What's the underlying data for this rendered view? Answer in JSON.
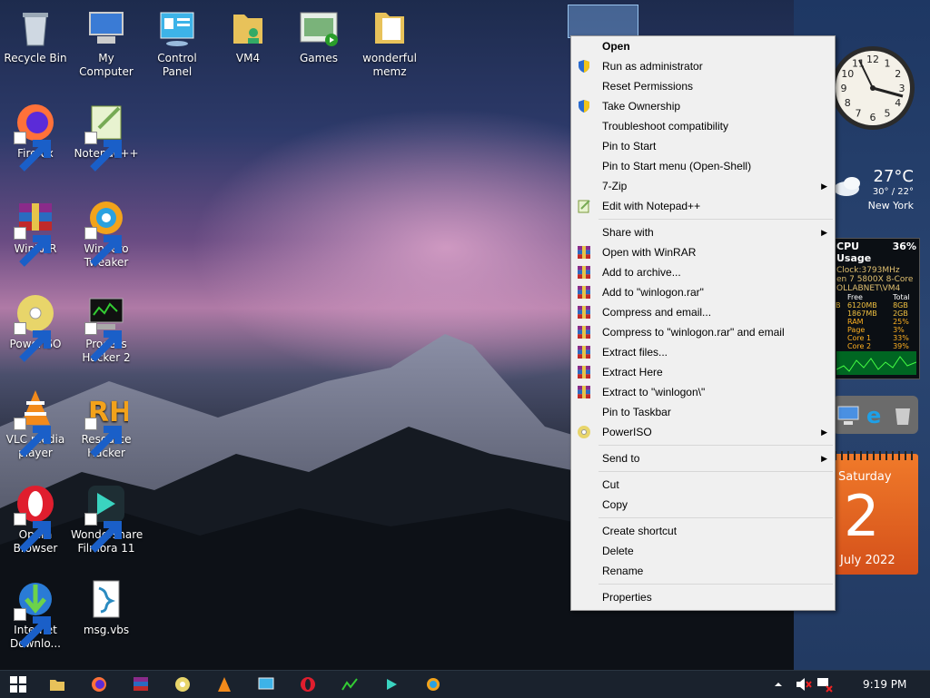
{
  "desktop": {
    "icons": [
      {
        "label": "Recycle Bin",
        "icon": "recycle-bin-icon"
      },
      {
        "label": "My Computer",
        "icon": "computer-icon"
      },
      {
        "label": "Control Panel",
        "icon": "control-panel-icon"
      },
      {
        "label": "VM4",
        "icon": "folder-user-icon"
      },
      {
        "label": "Games",
        "icon": "games-folder-icon"
      },
      {
        "label": "wonderful memz",
        "icon": "folder-icon"
      },
      {
        "label": "Firefox",
        "icon": "firefox-icon"
      },
      {
        "label": "Notepad++",
        "icon": "notepad-plus-plus-icon"
      },
      {
        "label": "WinRAR",
        "icon": "winrar-icon"
      },
      {
        "label": "Winaero Tweaker",
        "icon": "winaero-tweaker-icon"
      },
      {
        "label": "PowerISO",
        "icon": "poweriso-icon"
      },
      {
        "label": "Process Hacker 2",
        "icon": "process-hacker-icon"
      },
      {
        "label": "VLC media player",
        "icon": "vlc-icon"
      },
      {
        "label": "Resource Hacker",
        "icon": "resource-hacker-icon"
      },
      {
        "label": "Opera Browser",
        "icon": "opera-icon"
      },
      {
        "label": "Wondershare Filmora 11",
        "icon": "filmora-icon"
      },
      {
        "label": "Internet Downlo...",
        "icon": "internet-download-manager-icon"
      },
      {
        "label": "msg.vbs",
        "icon": "vbs-script-icon"
      }
    ]
  },
  "context_menu": {
    "groups": [
      [
        {
          "label": "Open",
          "bold": true
        },
        {
          "label": "Run as administrator",
          "icon": "uac-shield-icon"
        },
        {
          "label": "Reset Permissions"
        },
        {
          "label": "Take Ownership",
          "icon": "uac-shield-icon"
        },
        {
          "label": "Troubleshoot compatibility"
        },
        {
          "label": "Pin to Start"
        },
        {
          "label": "Pin to Start menu (Open-Shell)"
        },
        {
          "label": "7-Zip",
          "submenu": true
        },
        {
          "label": "Edit with Notepad++",
          "icon": "notepad-plus-plus-icon"
        }
      ],
      [
        {
          "label": "Share with",
          "submenu": true
        },
        {
          "label": "Open with WinRAR",
          "icon": "winrar-icon"
        },
        {
          "label": "Add to archive...",
          "icon": "winrar-icon"
        },
        {
          "label": "Add to \"winlogon.rar\"",
          "icon": "winrar-icon"
        },
        {
          "label": "Compress and email...",
          "icon": "winrar-icon"
        },
        {
          "label": "Compress to \"winlogon.rar\" and email",
          "icon": "winrar-icon"
        },
        {
          "label": "Extract files...",
          "icon": "winrar-icon"
        },
        {
          "label": "Extract Here",
          "icon": "winrar-icon"
        },
        {
          "label": "Extract to \"winlogon\\\"",
          "icon": "winrar-icon"
        },
        {
          "label": "Pin to Taskbar"
        },
        {
          "label": "PowerISO",
          "icon": "poweriso-icon",
          "submenu": true
        }
      ],
      [
        {
          "label": "Send to",
          "submenu": true
        }
      ],
      [
        {
          "label": "Cut"
        },
        {
          "label": "Copy"
        }
      ],
      [
        {
          "label": "Create shortcut"
        },
        {
          "label": "Delete"
        },
        {
          "label": "Rename"
        }
      ],
      [
        {
          "label": "Properties"
        }
      ]
    ]
  },
  "gadgets": {
    "clock": {
      "numerals": [
        "12",
        "1",
        "2",
        "3",
        "4",
        "5",
        "6",
        "7",
        "8",
        "9",
        "10",
        "11"
      ]
    },
    "weather": {
      "temp": "27°C",
      "range": "30° / 22°",
      "city": "New York"
    },
    "cpu": {
      "title": "CPU Usage",
      "usage": "36%",
      "clock": "Clock:3793MHz",
      "model": "en 7 5800X 8-Core",
      "machine": "OLLABNET\\VM4",
      "headers": [
        "",
        "Free",
        "Total"
      ],
      "rows": [
        [
          "B",
          "6120MB",
          "8GB"
        ],
        [
          "",
          "1867MB",
          "2GB"
        ]
      ],
      "stats": [
        {
          "label": "RAM",
          "value": "25%"
        },
        {
          "label": "Page",
          "value": "3%"
        },
        {
          "label": "Core 1",
          "value": "33%"
        },
        {
          "label": "Core 2",
          "value": "39%"
        }
      ]
    },
    "calendar": {
      "weekday": "Saturday",
      "day": "2",
      "month_year": "July 2022"
    }
  },
  "taskbar": {
    "time": "9:19 PM",
    "apps": [
      "start-icon",
      "file-explorer-icon",
      "firefox-icon",
      "winrar-icon",
      "poweriso-icon",
      "vlc-icon",
      "control-panel-icon",
      "opera-icon",
      "process-hacker-icon",
      "filmora-icon",
      "winaero-tweaker-icon"
    ],
    "tray": [
      "show-hidden-icons-icon",
      "volume-muted-icon",
      "network-disconnected-icon"
    ]
  }
}
